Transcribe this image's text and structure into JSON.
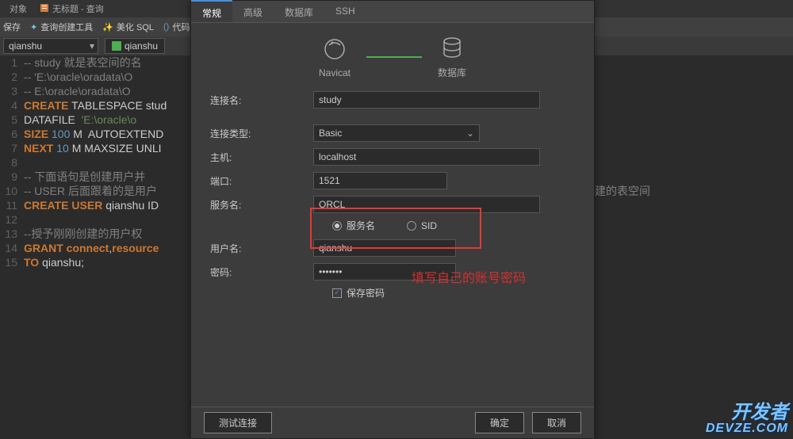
{
  "tabs": {
    "objects": "对象",
    "query": "无标题 - 查询"
  },
  "toolbar": {
    "save": "保存",
    "builder": "查询创建工具",
    "beautify": "美化 SQL",
    "snippet": "代码段"
  },
  "conn": {
    "select": "qianshu",
    "button": "qianshu"
  },
  "editor_lines": [
    {
      "n": 1,
      "cm": "-- study 就是表空间的名"
    },
    {
      "n": 2,
      "cm": "-- 'E:\\oracle\\oradata\\O"
    },
    {
      "n": 3,
      "cm": "-- E:\\oracle\\oradata\\O"
    },
    {
      "n": 4,
      "kw1": "CREATE",
      "id1": " TABLESPACE",
      "id2": " stud"
    },
    {
      "n": 5,
      "id1": "DATAFILE  ",
      "str": "'E:\\oracle\\o"
    },
    {
      "n": 6,
      "kw1": "SIZE",
      "num": " 100",
      "id1": " M  AUTOEXTEND"
    },
    {
      "n": 7,
      "kw1": "NEXT",
      "num": " 10",
      "id1": " M MAXSIZE UNLI"
    },
    {
      "n": 8,
      "cm": ""
    },
    {
      "n": 9,
      "cm": "-- 下面语句是创建用户并"
    },
    {
      "n": 10,
      "cm": "-- USER 后面跟着的是用户",
      "tail": "建的表空间"
    },
    {
      "n": 11,
      "kw1": "CREATE",
      "kw2": " USER",
      "id1": " qianshu ID"
    },
    {
      "n": 12,
      "cm": ""
    },
    {
      "n": 13,
      "cm": "--授予刚刚创建的用户权"
    },
    {
      "n": 14,
      "kw1": "GRANT",
      "kw2": " connect",
      "id1": ",",
      "kw3": "resource"
    },
    {
      "n": 15,
      "kw1": "TO",
      "id1": " qianshu;"
    }
  ],
  "dialog": {
    "tabs": {
      "general": "常规",
      "advanced": "高级",
      "database": "数据库",
      "ssh": "SSH"
    },
    "header": {
      "navicat": "Navicat",
      "db": "数据库"
    },
    "labels": {
      "conn_name": "连接名:",
      "conn_type": "连接类型:",
      "host": "主机:",
      "port": "端口:",
      "service": "服务名:",
      "svc_radio": "服务名",
      "sid_radio": "SID",
      "user": "用户名:",
      "pass": "密码:",
      "save_pass": "保存密码"
    },
    "values": {
      "conn_name": "study",
      "conn_type": "Basic",
      "host": "localhost",
      "port": "1521",
      "service": "ORCL",
      "user": "qianshu",
      "pass": "•••••••"
    },
    "footer": {
      "test": "测试连接",
      "ok": "确定",
      "cancel": "取消"
    }
  },
  "annotation": "填写自己的账号密码",
  "watermark": {
    "line1": "开发者",
    "line2": "DEVZE.COM"
  }
}
